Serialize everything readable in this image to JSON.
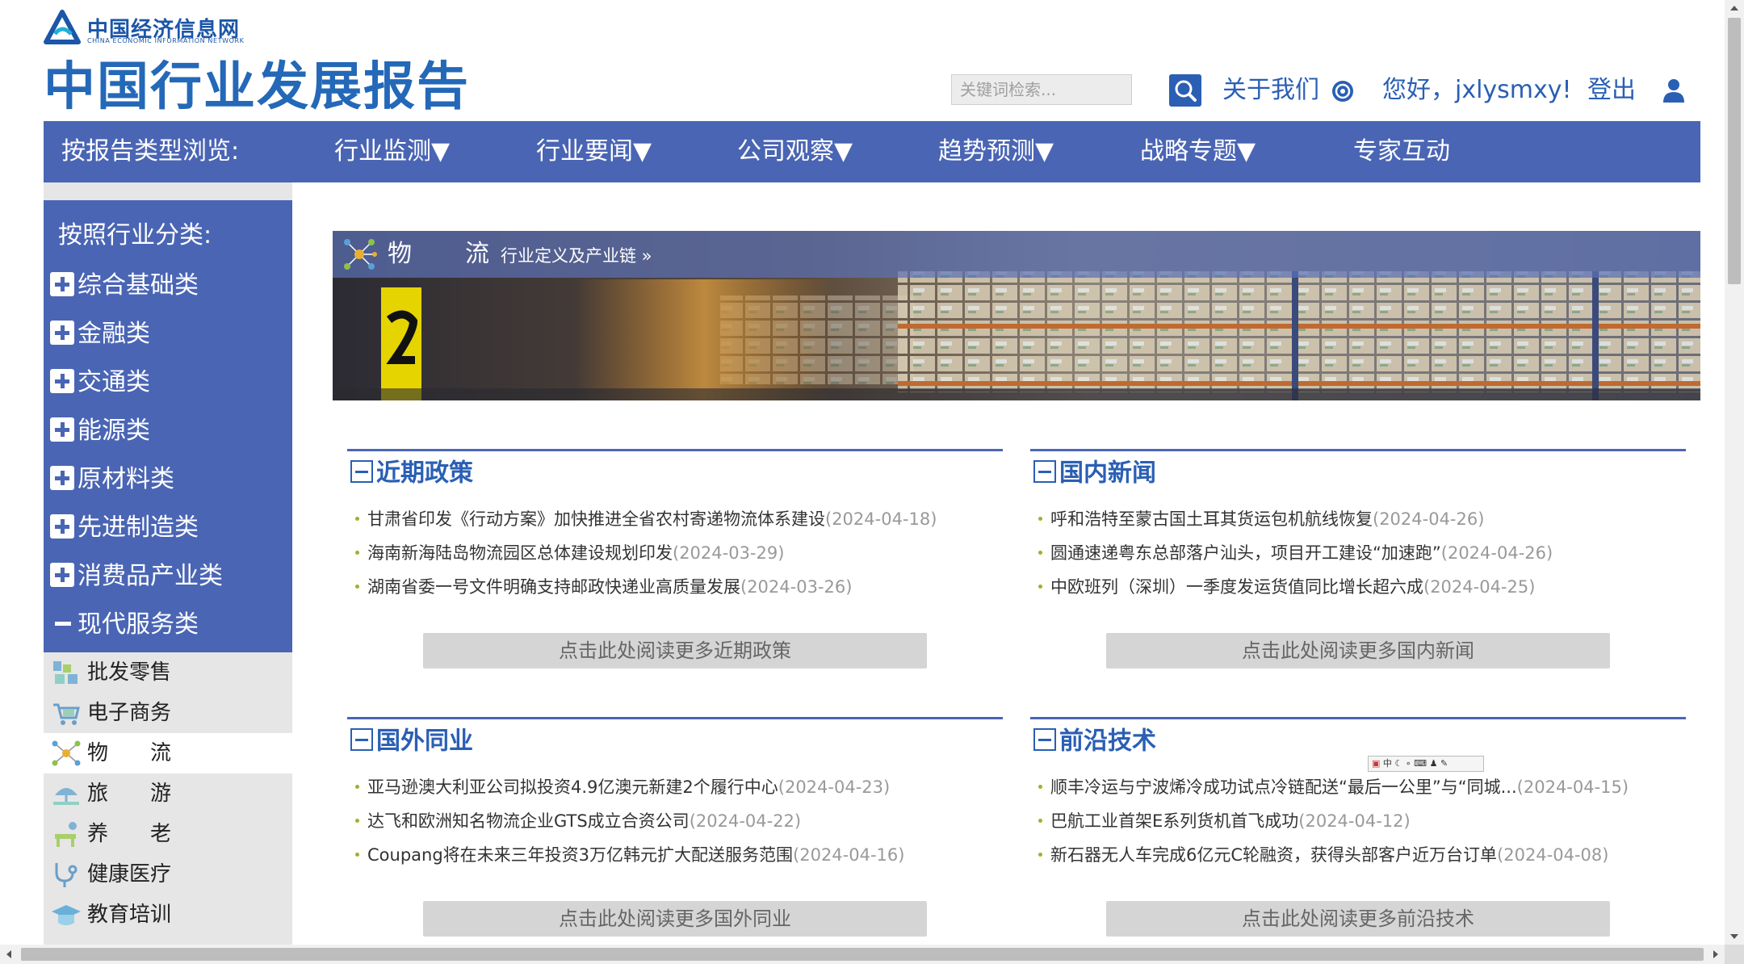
{
  "header": {
    "logo_cn": "中国经济信息网",
    "logo_en": "CHINA ECONOMIC INFORMATION NETWORK",
    "site_title": "中国行业发展报告",
    "search_placeholder": "关键词检索...",
    "about_label": "关于我们",
    "greeting": "您好，jxlysmxy!",
    "logout_label": "登出"
  },
  "nav": {
    "browse_label": "按报告类型浏览:",
    "items": [
      "行业监测▼",
      "行业要闻▼",
      "公司观察▼",
      "趋势预测▼",
      "战略专题▼",
      "专家互动"
    ]
  },
  "sidebar": {
    "title": "按照行业分类:",
    "categories": [
      "综合基础类",
      "金融类",
      "交通类",
      "能源类",
      "原材料类",
      "先进制造类",
      "消费品产业类",
      "现代服务类"
    ],
    "subcategories": [
      "批发零售",
      "电子商务",
      "物　　流",
      "旅　　游",
      "养　　老",
      "健康医疗",
      "教育培训"
    ],
    "active_sub": "物　　流"
  },
  "banner": {
    "title": "物　　流",
    "link": "行业定义及产业链 »"
  },
  "sections": [
    {
      "title": "近期政策",
      "items": [
        {
          "text": "甘肃省印发《行动方案》加快推进全省农村寄递物流体系建设",
          "date": "(2024-04-18)"
        },
        {
          "text": "海南新海陆岛物流园区总体建设规划印发",
          "date": "(2024-03-29)"
        },
        {
          "text": "湖南省委一号文件明确支持邮政快递业高质量发展",
          "date": "(2024-03-26)"
        }
      ],
      "more": "点击此处阅读更多近期政策"
    },
    {
      "title": "国内新闻",
      "items": [
        {
          "text": "呼和浩特至蒙古国土耳其货运包机航线恢复",
          "date": "(2024-04-26)"
        },
        {
          "text": "圆通速递粤东总部落户汕头，项目开工建设“加速跑”",
          "date": "(2024-04-26)"
        },
        {
          "text": "中欧班列（深圳）一季度发运货值同比增长超六成",
          "date": "(2024-04-25)"
        }
      ],
      "more": "点击此处阅读更多国内新闻"
    },
    {
      "title": "国外同业",
      "items": [
        {
          "text": "亚马逊澳大利亚公司拟投资4.9亿澳元新建2个履行中心",
          "date": "(2024-04-23)"
        },
        {
          "text": "达飞和欧洲知名物流企业GTS成立合资公司",
          "date": "(2024-04-22)"
        },
        {
          "text": "Coupang将在未来三年投资3万亿韩元扩大配送服务范围",
          "date": "(2024-04-16)"
        }
      ],
      "more": "点击此处阅读更多国外同业"
    },
    {
      "title": "前沿技术",
      "items": [
        {
          "text": "顺丰冷运与宁波烯冷成功试点冷链配送“最后一公里”与“同城...",
          "date": "(2024-04-15)"
        },
        {
          "text": "巴航工业首架E系列货机首飞成功",
          "date": "(2024-04-12)"
        },
        {
          "text": "新石器无人车完成6亿元C轮融资，获得头部客户近万台订单",
          "date": "(2024-04-08)"
        }
      ],
      "more": "点击此处阅读更多前沿技术"
    }
  ],
  "ime_toolbar": "中",
  "colors": {
    "brand_blue": "#4a65b4",
    "link_blue": "#2a5fb4",
    "bullet_green": "#9ab42c",
    "date_gray": "#999999"
  },
  "icons": [
    "logo-icon",
    "search-icon",
    "help-icon",
    "user-icon",
    "plus-icon",
    "minus-icon",
    "network-icon"
  ]
}
